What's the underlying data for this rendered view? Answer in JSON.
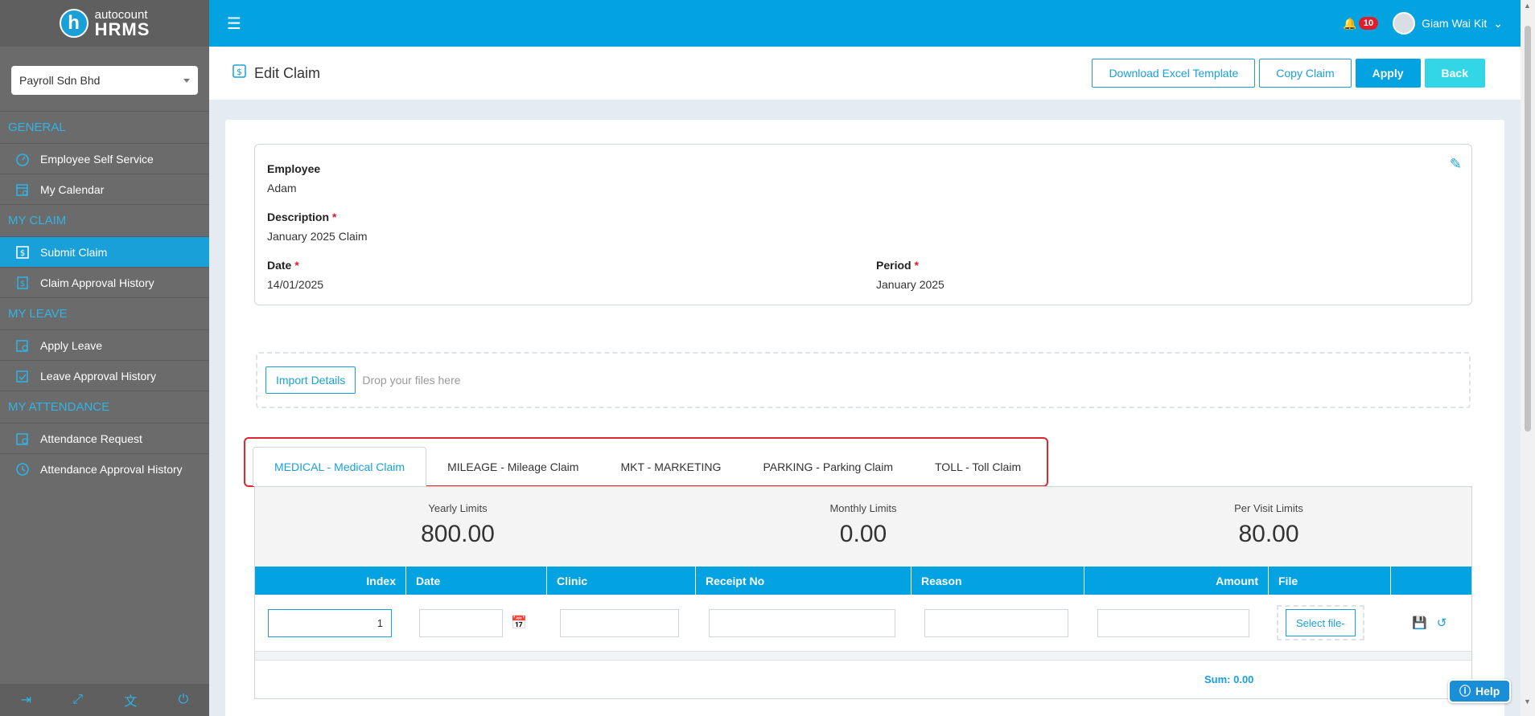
{
  "app": {
    "logo_top": "autocount",
    "logo_bottom": "HRMS",
    "logo_letter": "h"
  },
  "sidebar": {
    "company": "Payroll Sdn Bhd",
    "sections": [
      {
        "title": "GENERAL",
        "items": [
          {
            "label": "Employee Self Service",
            "icon": "dashboard-icon"
          },
          {
            "label": "My Calendar",
            "icon": "calendar-user-icon"
          }
        ]
      },
      {
        "title": "MY CLAIM",
        "items": [
          {
            "label": "Submit Claim",
            "icon": "claim-form-icon",
            "active": true
          },
          {
            "label": "Claim Approval History",
            "icon": "claim-history-icon"
          }
        ]
      },
      {
        "title": "MY LEAVE",
        "items": [
          {
            "label": "Apply Leave",
            "icon": "leave-icon"
          },
          {
            "label": "Leave Approval History",
            "icon": "leave-history-icon"
          }
        ]
      },
      {
        "title": "MY ATTENDANCE",
        "items": [
          {
            "label": "Attendance Request",
            "icon": "attendance-icon"
          },
          {
            "label": "Attendance Approval History",
            "icon": "attendance-history-icon"
          }
        ]
      }
    ],
    "footer_icons": [
      "logout-icon",
      "fullscreen-icon",
      "language-icon",
      "power-icon"
    ]
  },
  "topbar": {
    "notification_count": "10",
    "user_name": "Giam Wai Kit"
  },
  "page": {
    "title": "Edit Claim",
    "buttons": {
      "download": "Download Excel Template",
      "copy": "Copy Claim",
      "apply": "Apply",
      "back": "Back"
    }
  },
  "claim": {
    "employee_label": "Employee",
    "employee_value": "Adam",
    "description_label": "Description",
    "description_value": "January 2025 Claim",
    "date_label": "Date",
    "date_value": "14/01/2025",
    "period_label": "Period",
    "period_value": "January 2025",
    "required_mark": "*"
  },
  "import": {
    "button": "Import Details",
    "drop_text": "Drop your files here"
  },
  "tabs": [
    {
      "label": "MEDICAL - Medical Claim",
      "active": true
    },
    {
      "label": "MILEAGE - Mileage Claim"
    },
    {
      "label": "MKT - MARKETING"
    },
    {
      "label": "PARKING - Parking Claim"
    },
    {
      "label": "TOLL - Toll Claim"
    }
  ],
  "limits": [
    {
      "label": "Yearly Limits",
      "value": "800.00"
    },
    {
      "label": "Monthly Limits",
      "value": "0.00"
    },
    {
      "label": "Per Visit Limits",
      "value": "80.00"
    }
  ],
  "grid": {
    "columns": [
      "Index",
      "Date",
      "Clinic",
      "Receipt No",
      "Reason",
      "Amount",
      "File",
      ""
    ],
    "row": {
      "index": "1",
      "select_file": "Select file-"
    },
    "sum": "Sum: 0.00"
  },
  "help": {
    "label": "Help"
  },
  "colors": {
    "accent": "#03a3e2",
    "sidebar": "#6b6b6b",
    "danger": "#e11d2a",
    "highlight_border": "#e0262e"
  }
}
